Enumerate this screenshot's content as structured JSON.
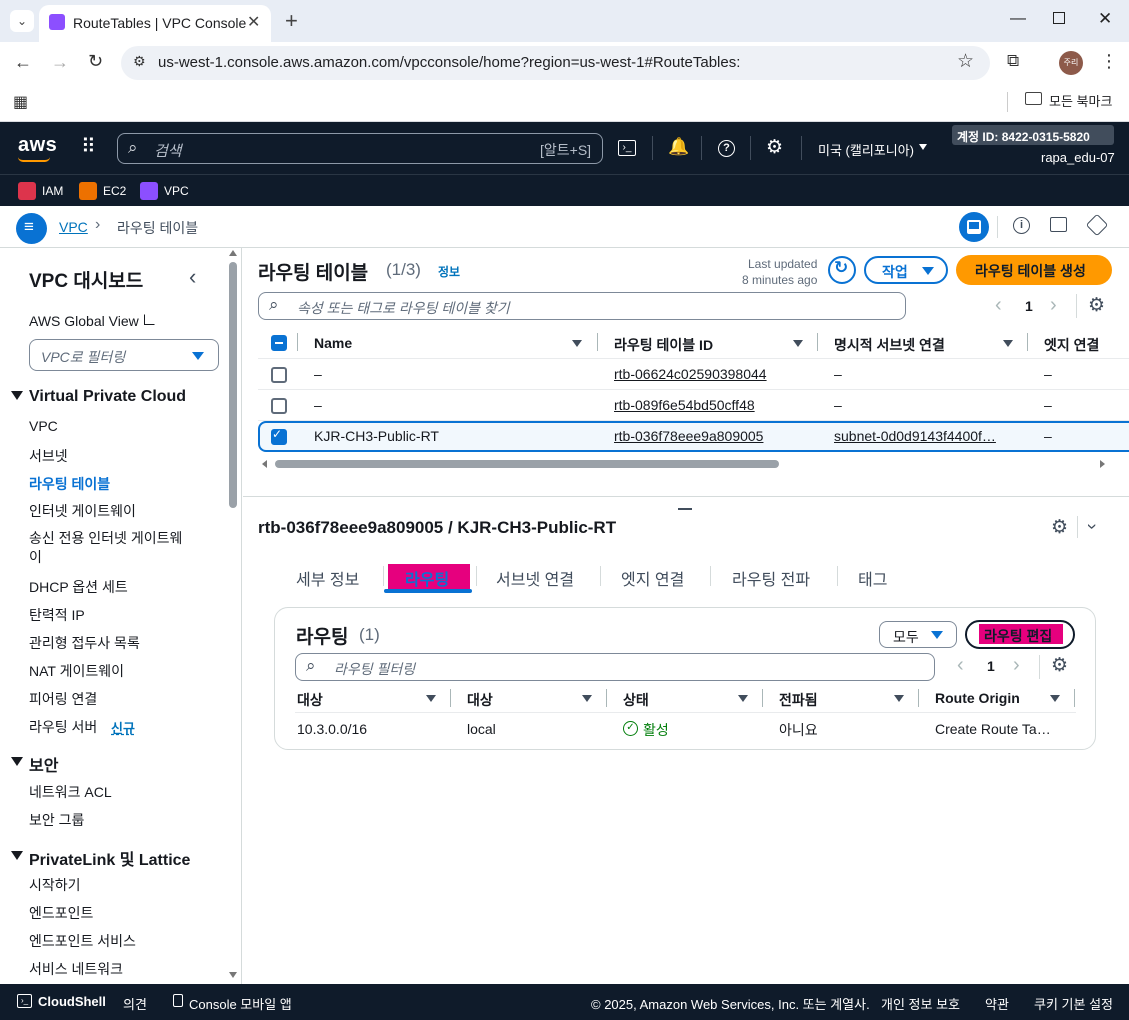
{
  "browser": {
    "tab_title": "RouteTables | VPC Console",
    "url": "us-west-1.console.aws.amazon.com/vpcconsole/home?region=us-west-1#RouteTables:",
    "bookmarks_folder": "모든 북마크",
    "profile_initial": "주리"
  },
  "aws": {
    "logo": "aws",
    "search_placeholder": "검색",
    "search_shortcut": "[알트+S]",
    "region": "미국 (캘리포니아)",
    "account_id": "계정 ID: 8422-0315-5820",
    "username": "rapa_edu-07",
    "favorites": [
      {
        "label": "IAM",
        "color": "#dd344c"
      },
      {
        "label": "EC2",
        "color": "#ed7100"
      },
      {
        "label": "VPC",
        "color": "#8c4fff"
      }
    ]
  },
  "breadcrumb": {
    "root": "VPC",
    "current": "라우팅 테이블"
  },
  "sidebar": {
    "title": "VPC 대시보드",
    "global_view": "AWS Global View",
    "filter_placeholder": "VPC로 필터링",
    "sections": [
      {
        "title": "Virtual Private Cloud",
        "items": [
          "VPC",
          "서브넷",
          "라우팅 테이블",
          "인터넷 게이트웨이",
          "송신 전용 인터넷 게이트웨이",
          "DHCP 옵션 세트",
          "탄력적 IP",
          "관리형 접두사 목록",
          "NAT 게이트웨이",
          "피어링 연결",
          "라우팅 서버"
        ]
      },
      {
        "title": "보안",
        "items": [
          "네트워크 ACL",
          "보안 그룹"
        ]
      },
      {
        "title": "PrivateLink 및 Lattice",
        "items": [
          "시작하기",
          "엔드포인트",
          "엔드포인트 서비스",
          "서비스 네트워크"
        ]
      }
    ],
    "egress_line1": "송신 전용 인터넷 게이트웨",
    "egress_line2": "이",
    "new_badge": "신규",
    "active_item": "라우팅 테이블"
  },
  "route_tables": {
    "title": "라우팅 테이블",
    "count": "(1/3)",
    "info": "정보",
    "last_updated_label": "Last updated",
    "last_updated_value": "8 minutes ago",
    "actions_label": "작업",
    "create_label": "라우팅 테이블 생성",
    "search_placeholder": "속성 또는 태그로 라우팅 테이블 찾기",
    "page": "1",
    "columns": [
      "Name",
      "라우팅 테이블 ID",
      "명시적 서브넷 연결",
      "엣지 연결"
    ],
    "rows": [
      {
        "name": "–",
        "id": "rtb-06624c02590398044",
        "subnet": "–",
        "edge": "–",
        "selected": false
      },
      {
        "name": "–",
        "id": "rtb-089f6e54bd50cff48",
        "subnet": "–",
        "edge": "–",
        "selected": false
      },
      {
        "name": "KJR-CH3-Public-RT",
        "id": "rtb-036f78eee9a809005",
        "subnet": "subnet-0d0d9143f4400f…",
        "edge": "–",
        "selected": true
      }
    ]
  },
  "detail": {
    "title": "rtb-036f78eee9a809005 / KJR-CH3-Public-RT",
    "tabs": [
      "세부 정보",
      "라우팅",
      "서브넷 연결",
      "엣지 연결",
      "라우팅 전파",
      "태그"
    ],
    "active_tab": "라우팅",
    "routes": {
      "title": "라우팅",
      "count": "(1)",
      "filter_select": "모두",
      "edit_label": "라우팅 편집",
      "filter_placeholder": "라우팅 필터링",
      "page": "1",
      "columns": [
        "대상",
        "대상",
        "상태",
        "전파됨",
        "Route Origin"
      ],
      "rows": [
        {
          "destination": "10.3.0.0/16",
          "target": "local",
          "status": "활성",
          "propagated": "아니요",
          "origin": "Create Route Ta…"
        }
      ]
    }
  },
  "footer": {
    "cloudshell": "CloudShell",
    "feedback": "의견",
    "mobile": "Console 모바일 앱",
    "copyright": "© 2025, Amazon Web Services, Inc. 또는 계열사.",
    "privacy": "개인 정보 보호",
    "terms": "약관",
    "cookies": "쿠키 기본 설정"
  },
  "colors": {
    "aws_nav": "#0f1b2a",
    "link": "#0073bb",
    "primary_button": "#ff9900",
    "selected": "#0972d3",
    "highlight": "#e6007e",
    "success": "#037f0c"
  }
}
